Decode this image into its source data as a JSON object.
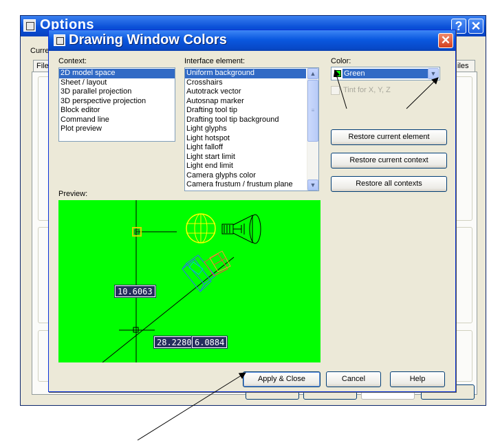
{
  "options_window": {
    "title": "Options",
    "current_label": "Curre",
    "tab_left": "File",
    "tab_right": "iles"
  },
  "dialog": {
    "title": "Drawing Window Colors",
    "context": {
      "label": "Context:",
      "items": [
        "2D model space",
        "Sheet / layout",
        "3D parallel projection",
        "3D perspective projection",
        "Block editor",
        "Command line",
        "Plot preview"
      ],
      "selected": "2D model space"
    },
    "interface_element": {
      "label": "Interface element:",
      "items": [
        "Uniform background",
        "Crosshairs",
        "Autotrack vector",
        "Autosnap marker",
        "Drafting tool tip",
        "Drafting tool tip background",
        "Light glyphs",
        "Light hotspot",
        "Light falloff",
        "Light start limit",
        "Light end limit",
        "Camera glyphs color",
        "Camera frustum / frustum plane"
      ],
      "selected": "Uniform background"
    },
    "color": {
      "label": "Color:",
      "value": "Green",
      "swatch": "#00ff00"
    },
    "tint_checkbox_label": "Tint for X, Y, Z",
    "buttons": {
      "restore_current_element": "Restore current element",
      "restore_current_context": "Restore current context",
      "restore_all_contexts": "Restore all contexts",
      "apply_close": "Apply & Close",
      "cancel": "Cancel",
      "help": "Help"
    },
    "preview": {
      "label": "Preview:",
      "background": "#00ff00",
      "dimension_1": "10.6063",
      "dimension_2": "28.2280",
      "dimension_3": "6.0884"
    }
  },
  "colors": {
    "title_bar": "#0a58e0",
    "selection": "#316ac5",
    "close_button": "#d4401e",
    "dialog_face": "#ece9d8"
  }
}
